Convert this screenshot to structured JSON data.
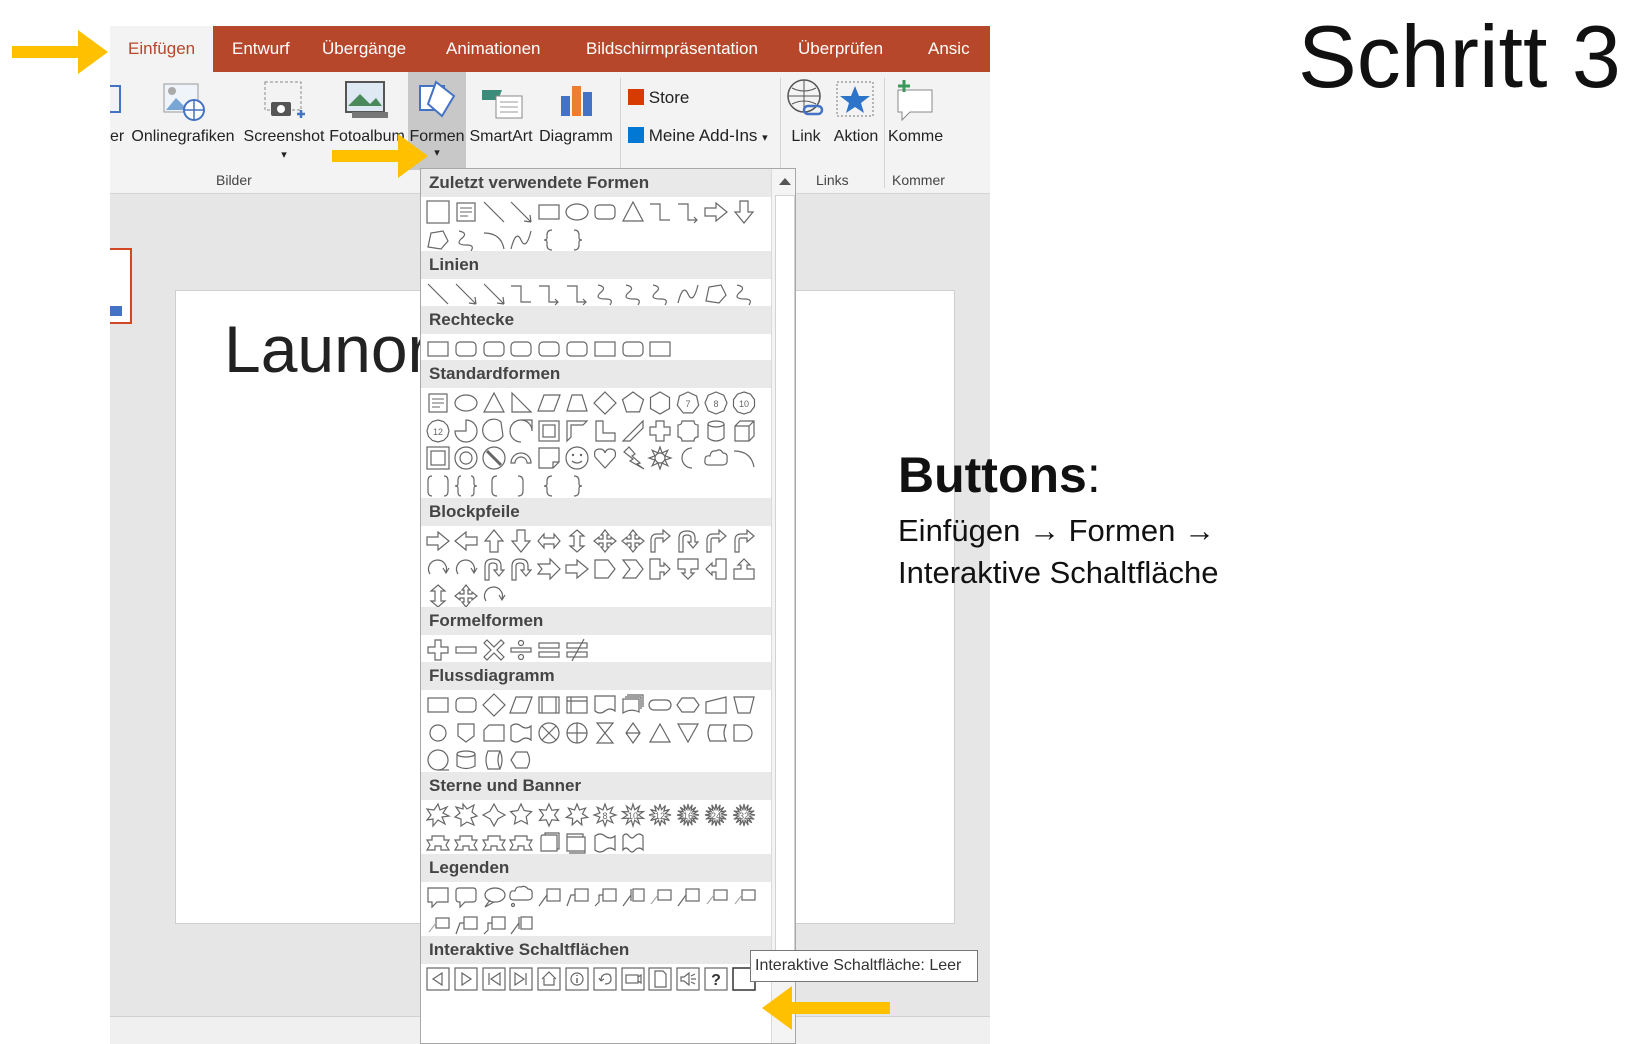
{
  "tabs": [
    "Einfügen",
    "Entwurf",
    "Übergänge",
    "Animationen",
    "Bildschirmpräsentation",
    "Überprüfen",
    "Ansic"
  ],
  "ribbon": {
    "partial_left": "er",
    "buttons": [
      "Onlinegrafiken",
      "Screenshot",
      "Fotoalbum",
      "Formen",
      "SmartArt",
      "Diagramm",
      "Link",
      "Aktion",
      "Komme"
    ],
    "store": "Store",
    "addins": "Meine Add-Ins",
    "groups": [
      "Bilder",
      "Links",
      "Kommer"
    ]
  },
  "slide": {
    "title": "Launor"
  },
  "gallery": {
    "categories": [
      "Zuletzt verwendete Formen",
      "Linien",
      "Rechtecke",
      "Standardformen",
      "Blockpfeile",
      "Formelformen",
      "Flussdiagramm",
      "Sterne und Banner",
      "Legenden",
      "Interaktive Schaltflächen"
    ],
    "tooltip": "Interaktive Schaltfläche: Leer",
    "star_points": [
      "8",
      "10",
      "12",
      "16",
      "24",
      "32"
    ],
    "heptagon_num": "7",
    "octagon_num": "8",
    "decagon_num": "10",
    "dodecagon_num": "12"
  },
  "annotation": {
    "step": "Schritt 3",
    "heading": "Buttons",
    "colon": ":",
    "line1": "Einfügen → Formen →",
    "line2": "Interaktive Schaltfläche"
  },
  "colors": {
    "accent": "#b7472a",
    "arrow": "#ffc000"
  }
}
